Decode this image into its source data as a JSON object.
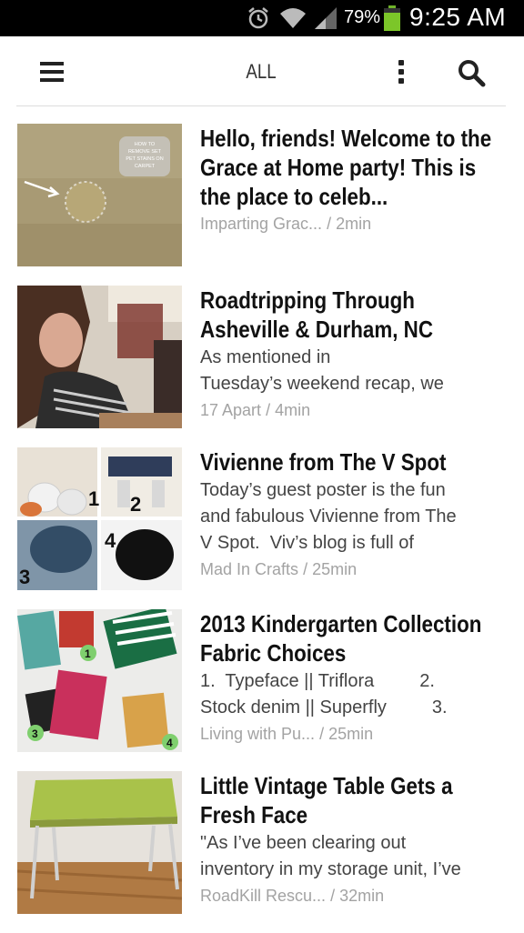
{
  "status_bar": {
    "battery_percent": "79%",
    "time": "9:25 AM",
    "icons": [
      "alarm-icon",
      "wifi-icon",
      "signal-icon",
      "battery-icon"
    ]
  },
  "toolbar": {
    "title": "ALL",
    "icons": [
      "menu-icon",
      "overflow-menu-icon",
      "search-icon"
    ]
  },
  "feed": {
    "items": [
      {
        "headline": "Hello, friends!  Welcome to the Grace at Home party!  This is the place to celeb...",
        "snippet": "",
        "source": "Imparting Grac...",
        "read_time": "2min",
        "thumb_text": "HOW TO REMOVE SET PET STAINS ON CARPET"
      },
      {
        "headline": "Roadtripping Through Asheville & Durham, NC",
        "snippet": "As mentioned in\nTuesday’s weekend recap, we",
        "source": "17 Apart",
        "read_time": "4min"
      },
      {
        "headline": "Vivienne from The V Spot",
        "snippet": "Today’s guest poster is the fun\nand fabulous Vivienne from The\nV Spot.  Viv’s blog is full of",
        "source": "Mad In Crafts",
        "read_time": "25min",
        "thumb_numbers": [
          "1",
          "2",
          "3",
          "4"
        ]
      },
      {
        "headline": "2013 Kindergarten Collection Fabric Choices",
        "snippet": "1.  Typeface || Triflora         2.\nStock denim || Superfly         3.",
        "source": "Living with Pu...",
        "read_time": "25min",
        "thumb_numbers": [
          "1",
          "2",
          "3",
          "4"
        ]
      },
      {
        "headline": "Little Vintage Table Gets a Fresh Face",
        "snippet": "\"As I’ve been clearing out\ninventory in my storage unit, I’ve",
        "source": "RoadKill Rescu...",
        "read_time": "32min"
      }
    ],
    "separator": "/"
  }
}
